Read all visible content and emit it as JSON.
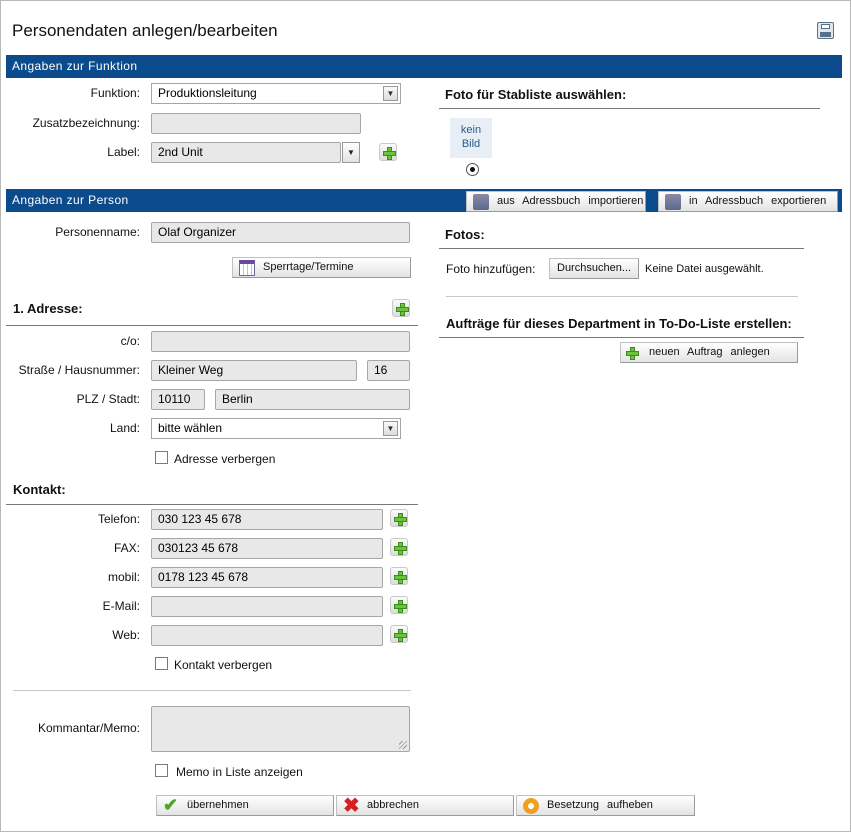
{
  "page": {
    "title": "Personendaten anlegen/bearbeiten",
    "save_icon": "floppy-disk-icon"
  },
  "funktion_section": {
    "header": "Angaben zur Funktion",
    "funktion_label": "Funktion:",
    "funktion_value": "Produktionsleitung",
    "zusatz_label": "Zusatzbezeichnung:",
    "zusatz_value": "",
    "label_label": "Label:",
    "label_value": "2nd Unit"
  },
  "foto_stab": {
    "heading": "Foto für Stabliste auswählen:",
    "kein_bild": "kein",
    "kein_bild2": "Bild"
  },
  "person_section": {
    "header": "Angaben zur Person",
    "import_button": "aus Adressbuch importieren",
    "export_button": "in Adressbuch exportieren",
    "name_label": "Personenname:",
    "name_value": "Olaf Organizer",
    "sperrtage_button": "Sperrtage/Termine"
  },
  "adresse": {
    "heading": "1. Adresse:",
    "co_label": "c/o:",
    "co_value": "",
    "strasse_label": "Straße / Hausnummer:",
    "strasse_value": "Kleiner Weg",
    "hausnr_value": "16",
    "plz_label": "PLZ / Stadt:",
    "plz_value": "10110",
    "stadt_value": "Berlin",
    "land_label": "Land:",
    "land_value": "bitte wählen",
    "hide_label": "Adresse verbergen"
  },
  "kontakt": {
    "heading": "Kontakt:",
    "telefon_label": "Telefon:",
    "telefon_value": "030 123 45 678",
    "fax_label": "FAX:",
    "fax_value": "030123 45 678",
    "mobil_label": "mobil:",
    "mobil_value": "0178 123 45 678",
    "email_label": "E-Mail:",
    "email_value": "",
    "web_label": "Web:",
    "web_value": "",
    "hide_label": "Kontakt verbergen"
  },
  "memo": {
    "label": "Kommantar/Memo:",
    "value": "",
    "show_label": "Memo in Liste anzeigen"
  },
  "fotos": {
    "heading": "Fotos:",
    "add_label": "Foto hinzufügen:",
    "browse_button": "Durchsuchen...",
    "no_file": "Keine Datei ausgewählt."
  },
  "todo": {
    "heading": "Aufträge für dieses Department in To-Do-Liste erstellen:",
    "new_button": "neuen Auftrag anlegen"
  },
  "footer": {
    "accept": "übernehmen",
    "cancel": "abbrechen",
    "cancel_cast": "Besetzung aufheben"
  },
  "colors": {
    "header_bar": "#0b4a8b",
    "input_bg": "#e8e8e8",
    "accent_green": "#6cc13e"
  }
}
